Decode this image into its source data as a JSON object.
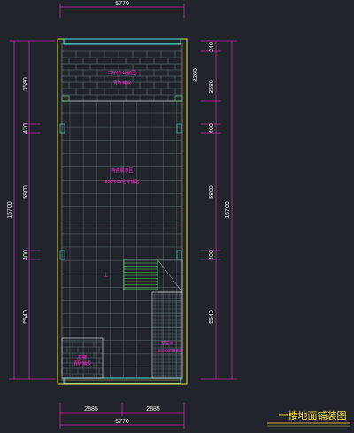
{
  "drawing": {
    "title": "一楼地面铺装图",
    "top_dim": "5770",
    "bottom_total": "5770",
    "bottom_left": "2885",
    "bottom_right": "2885",
    "left_dims": {
      "total": "15700",
      "d1": "3580",
      "d2": "420",
      "d3": "5800",
      "d4": "400",
      "d5": "5540"
    },
    "right_dims": {
      "total": "15700",
      "top": "240",
      "d1": "2200",
      "d2": "3580",
      "d3": "400",
      "d4": "5800",
      "d5": "400",
      "d6": "5540"
    },
    "rooms": {
      "top_name": "三厅(办公室区)",
      "top_finish": "青砖铺设",
      "center_name": "陶瓷展示区",
      "center_finish": "800*800地砖铺贴",
      "bottom_left_name": "楼梯",
      "bottom_left_finish": "青砖铺设",
      "toilet_name": "卫生间",
      "toilet_finish": "300*300防滑地砖",
      "stair_mark": "上"
    },
    "colors": {
      "background": "#21252b",
      "wall": "#e8e33a",
      "grid": "#6b7a84",
      "dim": "#ff2bd6",
      "cyan": "#4fe0e0",
      "green": "#5ad06a",
      "text": "#ff2bd6",
      "title": "#ffe14a"
    }
  }
}
